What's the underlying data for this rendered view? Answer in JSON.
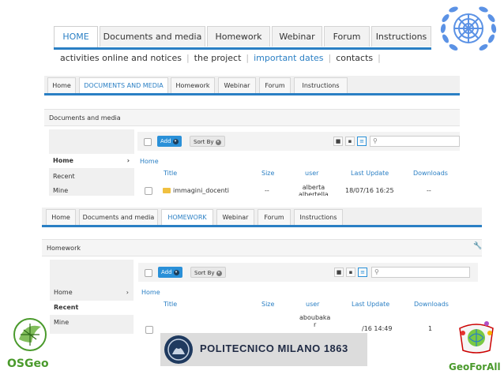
{
  "top_nav": {
    "tabs": [
      {
        "label": "HOME",
        "active": true
      },
      {
        "label": "Documents and media",
        "active": false
      },
      {
        "label": "Homework",
        "active": false
      },
      {
        "label": "Webinar",
        "active": false
      },
      {
        "label": "Forum",
        "active": false
      },
      {
        "label": "Instructions",
        "active": false
      }
    ],
    "subnav": [
      "activities online and notices",
      "the project",
      "important dates",
      "contacts"
    ],
    "subnav_active": "important dates"
  },
  "panel_documents": {
    "tabs": [
      "Home",
      "DOCUMENTS AND MEDIA",
      "Homework",
      "Webinar",
      "Forum",
      "Instructions"
    ],
    "active_tab": "DOCUMENTS AND MEDIA",
    "title": "Documents and media",
    "sidebar": [
      {
        "label": "Home",
        "selected": true,
        "chevron": "›"
      },
      {
        "label": "Recent",
        "selected": false
      },
      {
        "label": "Mine",
        "selected": false
      }
    ],
    "add_label": "Add",
    "sort_label": "Sort By",
    "breadcrumb": "Home",
    "columns": [
      "Title",
      "Size",
      "user",
      "Last Update",
      "Downloads"
    ],
    "rows": [
      {
        "title": "immagini_docenti",
        "size": "--",
        "user": "alberta\nalbertella",
        "last_update": "18/07/16 16:25",
        "downloads": "--"
      }
    ]
  },
  "panel_homework": {
    "tabs": [
      "Home",
      "Documents and media",
      "HOMEWORK",
      "Webinar",
      "Forum",
      "Instructions"
    ],
    "active_tab": "HOMEWORK",
    "title": "Homework",
    "sidebar": [
      {
        "label": "Home",
        "selected": false,
        "chevron": "›"
      },
      {
        "label": "Recent",
        "selected": true
      },
      {
        "label": "Mine",
        "selected": false
      }
    ],
    "add_label": "Add",
    "sort_label": "Sort By",
    "breadcrumb": "Home",
    "columns": [
      "Title",
      "Size",
      "user",
      "Last Update",
      "Downloads"
    ],
    "rows": [
      {
        "title": "",
        "size": "",
        "user": "aboubaka\nr",
        "last_update": "/16 14:49",
        "downloads": "1"
      }
    ]
  },
  "logos": {
    "osgeo": "OSGeo",
    "polimi": "POLITECNICO MILANO 1863",
    "geoforall": "GeoForAll"
  },
  "colors": {
    "accent": "#2a7fc4",
    "un_blue": "#5b92e5",
    "osgeo_green": "#4a9a2c"
  }
}
